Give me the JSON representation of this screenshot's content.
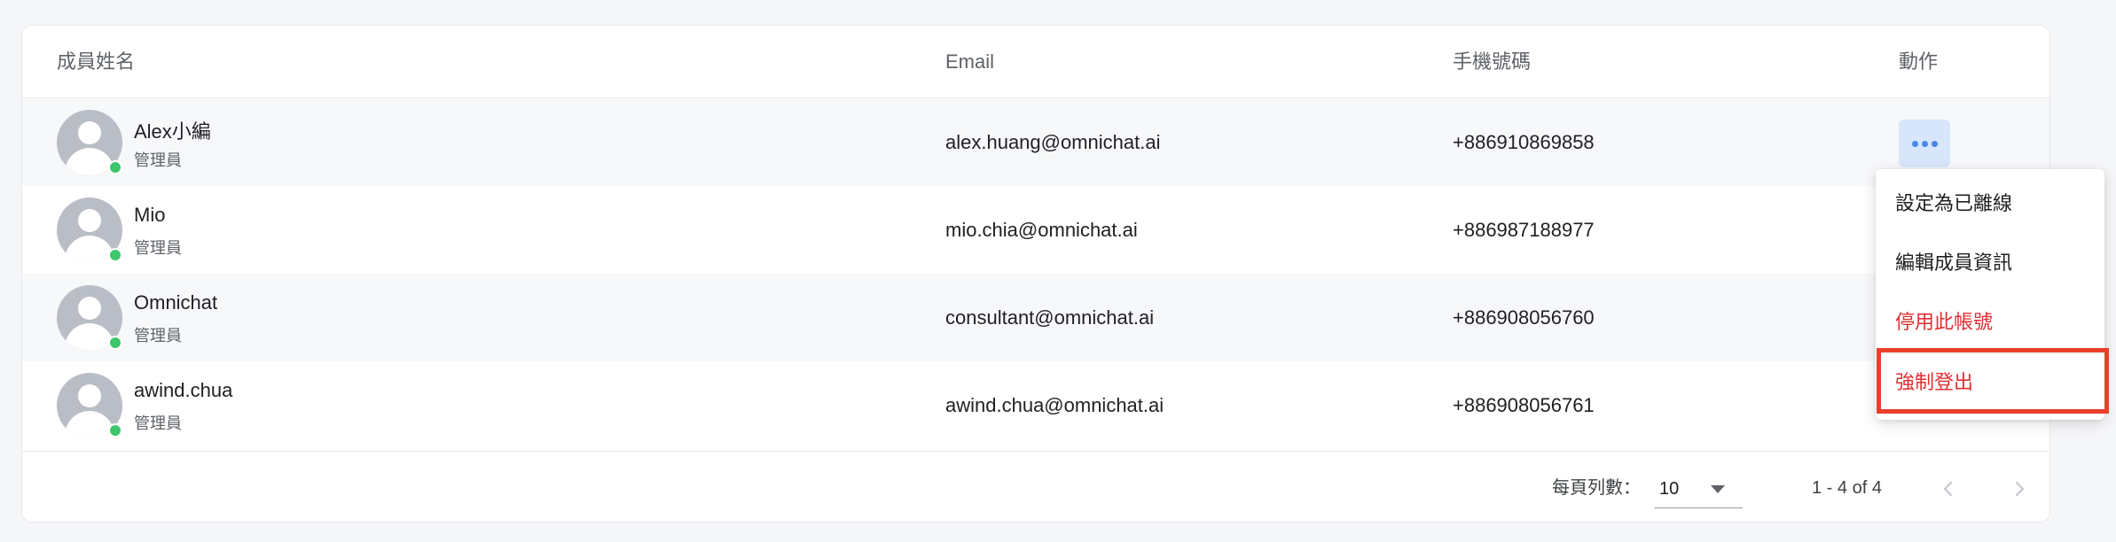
{
  "table": {
    "headers": {
      "name": "成員姓名",
      "email": "Email",
      "phone": "手機號碼",
      "action": "動作"
    },
    "rows": [
      {
        "name": "Alex小編",
        "role": "管理員",
        "email": "alex.huang@omnichat.ai",
        "phone": "+886910869858",
        "status": "online"
      },
      {
        "name": "Mio",
        "role": "管理員",
        "email": "mio.chia@omnichat.ai",
        "phone": "+886987188977",
        "status": "online"
      },
      {
        "name": "Omnichat",
        "role": "管理員",
        "email": "consultant@omnichat.ai",
        "phone": "+886908056760",
        "status": "online"
      },
      {
        "name": "awind.chua",
        "role": "管理員",
        "email": "awind.chua@omnichat.ai",
        "phone": "+886908056761",
        "status": "online"
      }
    ]
  },
  "action_menu": {
    "items": [
      {
        "label": "設定為已離線",
        "danger": false
      },
      {
        "label": "編輯成員資訊",
        "danger": false
      },
      {
        "label": "停用此帳號",
        "danger": true
      },
      {
        "label": "強制登出",
        "danger": true
      }
    ]
  },
  "pagination": {
    "rows_per_page_label": "每頁列數：",
    "rows_per_page": "10",
    "range": "1 - 4 of 4"
  },
  "colors": {
    "online": "#3cc76a",
    "danger": "#e02e33",
    "highlight": "#e8402a",
    "action_button_bg": "#d8e6fb"
  },
  "icons": {
    "action": "more-horizontal-icon",
    "prev": "chevron-left-icon",
    "next": "chevron-right-icon",
    "dropdown": "caret-down-icon",
    "avatar": "user-avatar-icon"
  }
}
